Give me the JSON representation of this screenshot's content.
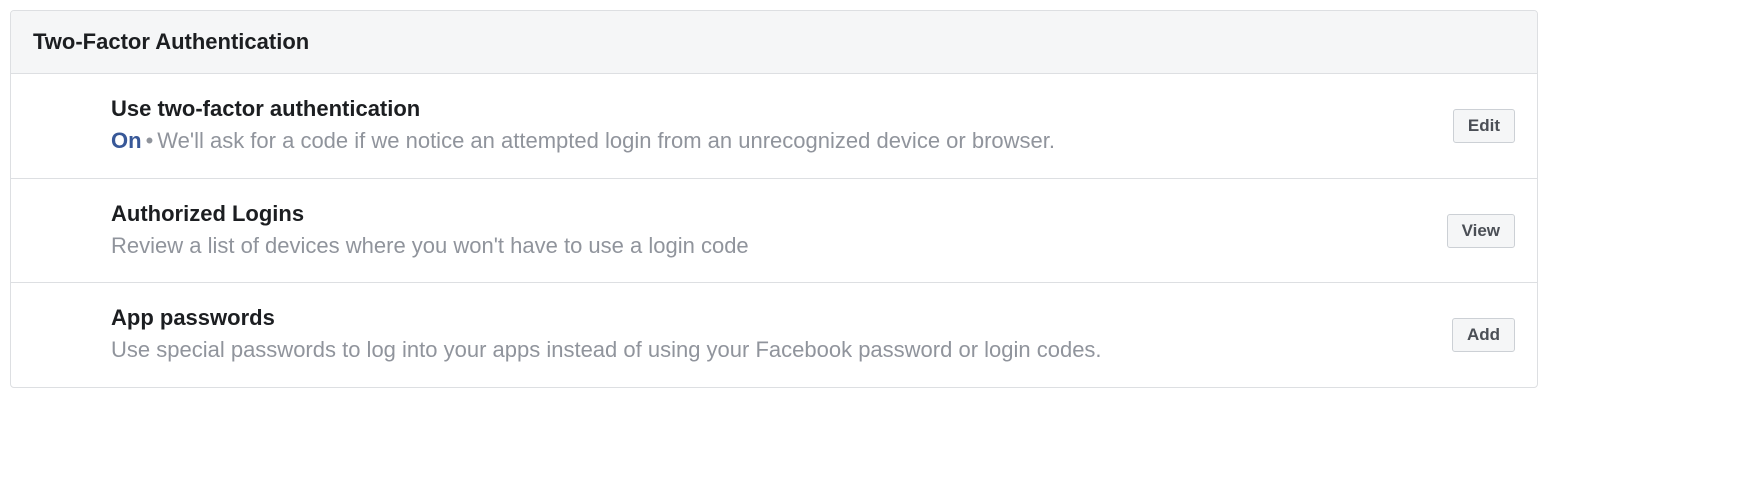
{
  "panel": {
    "title": "Two-Factor Authentication",
    "rows": [
      {
        "title": "Use two-factor authentication",
        "status": "On",
        "sep": "•",
        "desc": "We'll ask for a code if we notice an attempted login from an unrecognized device or browser.",
        "action": "Edit"
      },
      {
        "title": "Authorized Logins",
        "desc": "Review a list of devices where you won't have to use a login code",
        "action": "View"
      },
      {
        "title": "App passwords",
        "desc": "Use special passwords to log into your apps instead of using your Facebook password or login codes.",
        "action": "Add"
      }
    ]
  }
}
